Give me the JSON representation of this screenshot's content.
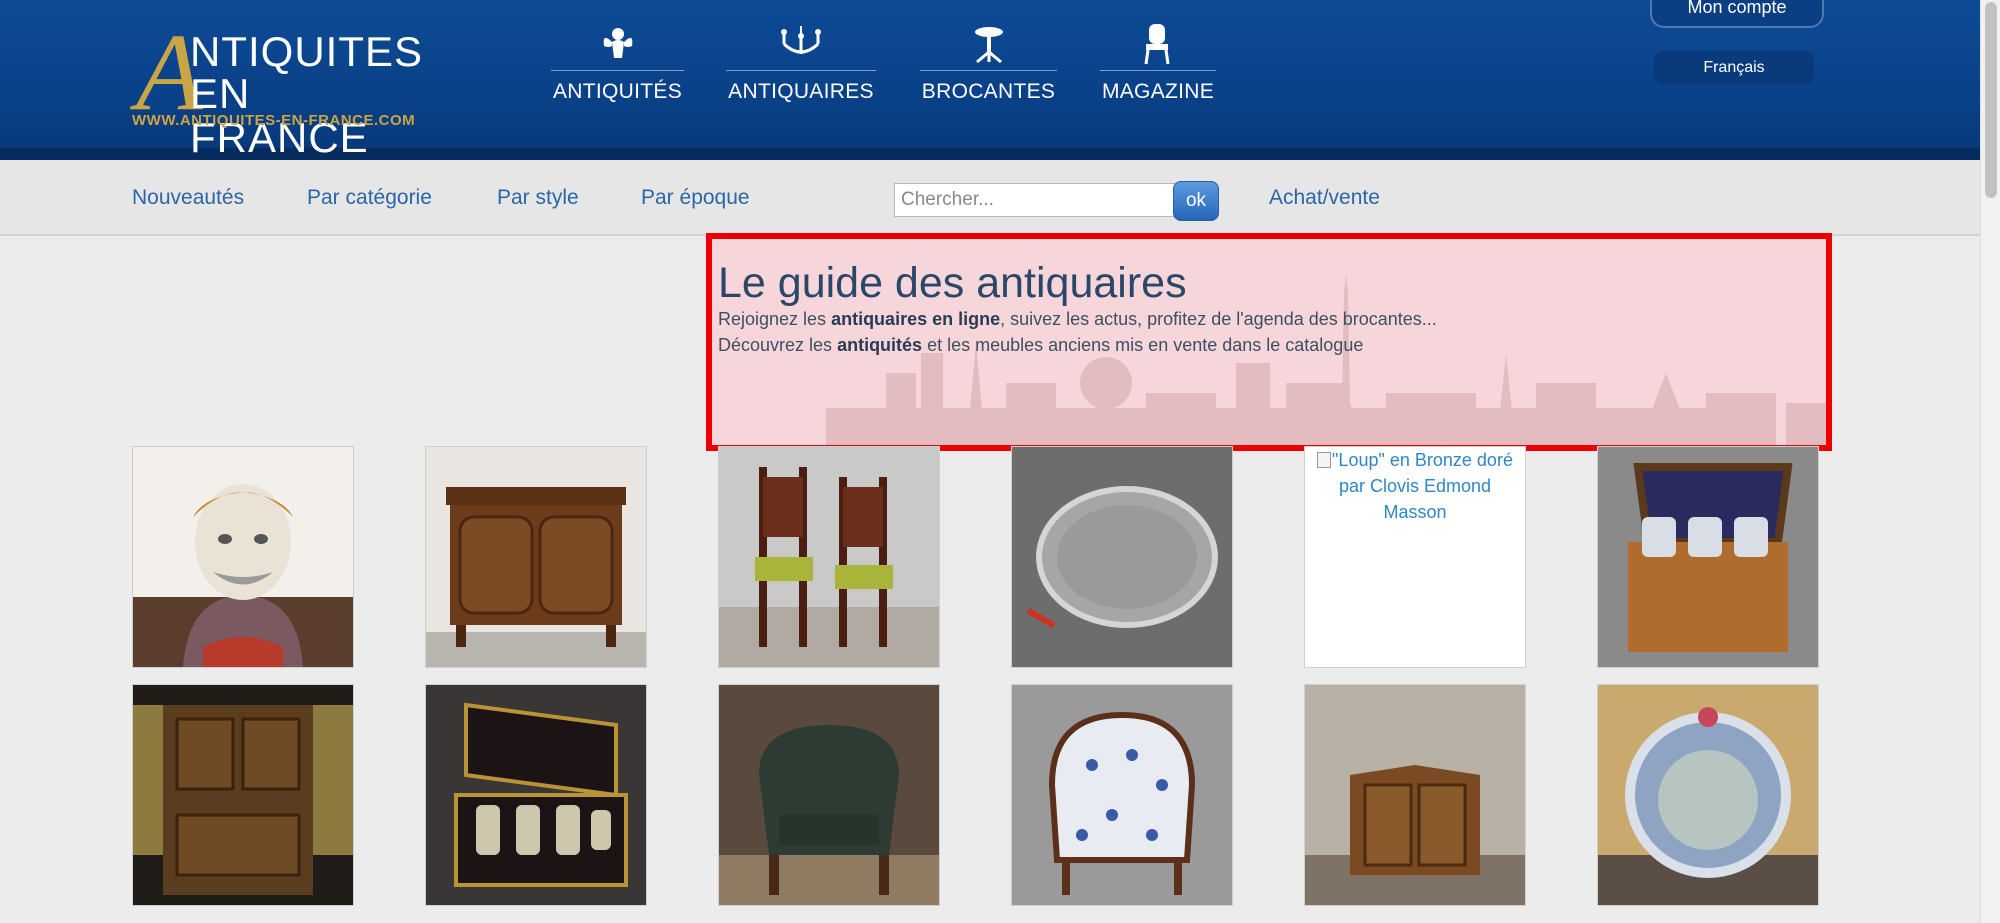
{
  "header": {
    "logo": {
      "line1": "NTIQUITES",
      "initial": "A",
      "line2": "EN FRANCE",
      "url": "WWW.ANTIQUITES-EN-FRANCE.COM"
    },
    "nav": [
      {
        "label": "ANTIQUITÉS",
        "icon": "cherub-icon"
      },
      {
        "label": "ANTIQUAIRES",
        "icon": "chandelier-icon"
      },
      {
        "label": "BROCANTES",
        "icon": "gueridon-table-icon"
      },
      {
        "label": "MAGAZINE",
        "icon": "armchair-icon"
      }
    ],
    "account_label": "Mon compte",
    "language_label": "Français"
  },
  "subnav": {
    "links": [
      "Nouveautés",
      "Par catégorie",
      "Par style",
      "Par époque"
    ],
    "search_placeholder": "Chercher...",
    "search_button": "ok",
    "buy_sell": "Achat/vente"
  },
  "banner": {
    "title": "Le guide des antiquaires",
    "line1_prefix": "Rejoignez les ",
    "line1_bold": "antiquaires en ligne",
    "line1_suffix": ", suivez les actus, profitez de l'agenda des brocantes...",
    "line2_prefix": "Découvrez les ",
    "line2_bold": "antiquités",
    "line2_suffix": " et les meubles anciens mis en vente dans le catalogue"
  },
  "products": [
    {
      "kind": "bust-jug"
    },
    {
      "kind": "walnut-cabinet"
    },
    {
      "kind": "pair-of-chairs"
    },
    {
      "kind": "silver-tray"
    },
    {
      "kind": "broken",
      "alt": "\"Loup\" en Bronze doré par Clovis Edmond Masson"
    },
    {
      "kind": "decanter-box"
    },
    {
      "kind": "tall-cabinet"
    },
    {
      "kind": "liquor-cellar"
    },
    {
      "kind": "leather-armchair"
    },
    {
      "kind": "floral-armchair"
    },
    {
      "kind": "corner-cabinet"
    },
    {
      "kind": "venetian-mirror"
    }
  ],
  "colors": {
    "header_blue": "#0a4188",
    "gold": "#c9a545",
    "link_blue": "#2a66a8",
    "highlight_red": "#ee0000"
  }
}
